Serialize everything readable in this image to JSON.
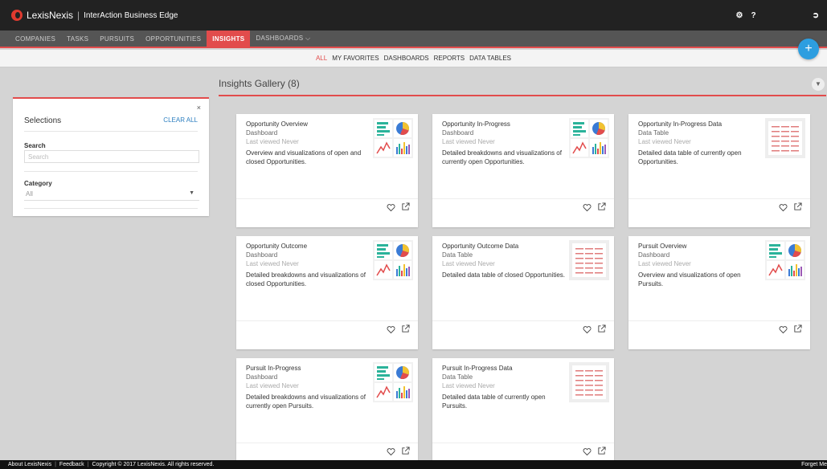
{
  "app": {
    "brand": "LexisNexis",
    "product": "InterAction Business Edge",
    "gear_icon": "gear-icon",
    "help_label": "?",
    "logout_icon": "logout-icon"
  },
  "nav": {
    "items": [
      {
        "label": "COMPANIES"
      },
      {
        "label": "TASKS"
      },
      {
        "label": "PURSUITS"
      },
      {
        "label": "OPPORTUNITIES"
      },
      {
        "label": "INSIGHTS"
      },
      {
        "label": "DASHBOARDS ⌵"
      }
    ]
  },
  "subnav": {
    "items": [
      "ALL",
      "MY FAVORITES",
      "DASHBOARDS",
      "REPORTS",
      "DATA TABLES"
    ]
  },
  "fab_label": "+",
  "gallery": {
    "title": "Insights Gallery (8)",
    "filter_icon": "filter-icon"
  },
  "selections": {
    "title": "Selections",
    "clear_all": "CLEAR ALL",
    "close": "×",
    "search_label": "Search",
    "search_placeholder": "Search",
    "category_label": "Category",
    "category_value": "All"
  },
  "cards": [
    {
      "title": "Opportunity Overview",
      "type": "Dashboard",
      "viewed": "Last viewed Never",
      "desc": "Overview and visualizations of open and closed Opportunities."
    },
    {
      "title": "Opportunity In-Progress",
      "type": "Dashboard",
      "viewed": "Last viewed Never",
      "desc": "Detailed breakdowns and visualizations of currently open Opportunities."
    },
    {
      "title": "Opportunity In-Progress Data",
      "type": "Data Table",
      "viewed": "Last viewed Never",
      "desc": "Detailed data table of currently open Opportunities."
    },
    {
      "title": "Opportunity Outcome",
      "type": "Dashboard",
      "viewed": "Last viewed Never",
      "desc": "Detailed breakdowns and visualizations of closed Opportunities."
    },
    {
      "title": "Opportunity Outcome Data",
      "type": "Data Table",
      "viewed": "Last viewed Never",
      "desc": "Detailed data table of closed Opportunities."
    },
    {
      "title": "Pursuit Overview",
      "type": "Dashboard",
      "viewed": "Last viewed Never",
      "desc": "Overview and visualizations of open Pursuits."
    },
    {
      "title": "Pursuit In-Progress",
      "type": "Dashboard",
      "viewed": "Last viewed Never",
      "desc": "Detailed breakdowns and visualizations of currently open Pursuits."
    },
    {
      "title": "Pursuit In-Progress Data",
      "type": "Data Table",
      "viewed": "Last viewed Never",
      "desc": "Detailed data table of currently open Pursuits."
    }
  ],
  "footer": {
    "about": "About LexisNexis",
    "feedback": "Feedback",
    "copyright": "Copyright © 2017 LexisNexis. All rights reserved.",
    "forget": "Forget Me"
  },
  "colors": {
    "accent": "#e24c4c",
    "link": "#2d7fc0",
    "fab": "#2d9ee0"
  }
}
